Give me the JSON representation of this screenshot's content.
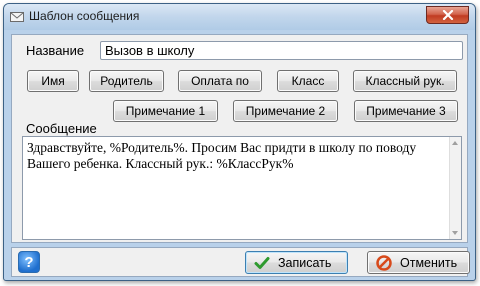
{
  "window": {
    "title": "Шаблон сообщения",
    "close_glyph": "✕"
  },
  "form": {
    "name_label": "Название",
    "name_value": "Вызов в школу",
    "message_label": "Сообщение",
    "message_text": "Здравствуйте, %Родитель%. Просим Вас придти в школу по поводу Вашего ребенка. Классный рук.: %КлассРук%"
  },
  "placeholder_buttons": [
    "Имя",
    "Родитель",
    "Оплата по",
    "Класс",
    "Классный рук."
  ],
  "note_buttons": [
    "Примечание 1",
    "Примечание 2",
    "Примечание 3"
  ],
  "actions": {
    "help_glyph": "?",
    "save_label": "Записать",
    "cancel_label": "Отменить"
  },
  "colors": {
    "window_frame": "#b9d1ea",
    "client_bg": "#f0f0f0",
    "save_icon": "#2e9a2e",
    "cancel_icon": "#d84a1b"
  },
  "icons": {
    "app": "envelope-icon",
    "help": "help-icon",
    "save": "checkmark-icon",
    "cancel": "cancel-icon"
  }
}
